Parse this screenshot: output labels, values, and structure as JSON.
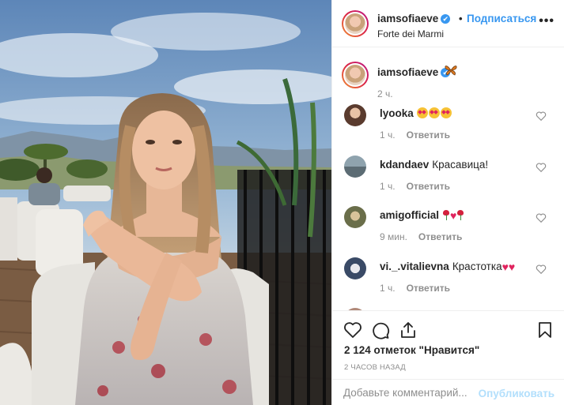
{
  "post": {
    "username": "iamsofiaeve",
    "verified_glyph": "✔",
    "dot": "•",
    "follow_label": "Подписаться",
    "location": "Forte dei Marmi",
    "more_glyph": "•••",
    "photo_description_icon": "photo"
  },
  "caption": {
    "username": "iamsofiaeve",
    "emoji": "butterfly",
    "time": "2 ч."
  },
  "comments": [
    {
      "username": "lyooka",
      "text": "",
      "emojis": [
        "heart-eyes",
        "heart-eyes",
        "heart-eyes"
      ],
      "time": "1 ч.",
      "reply": "Ответить",
      "avatar_color": "#5a3b2e"
    },
    {
      "username": "kdandaev",
      "text": "Красавица!",
      "emojis": [],
      "time": "1 ч.",
      "reply": "Ответить",
      "avatar_color": "#6f7f86"
    },
    {
      "username": "amigofficial",
      "text": "",
      "emojis": [
        "rose",
        "red-heart",
        "rose"
      ],
      "time": "9 мин.",
      "reply": "Ответить",
      "avatar_color": "#6a6e4a"
    },
    {
      "username": "vi._.vitalievna",
      "text": "Крастотка",
      "emojis": [
        "sparkling-heart",
        "sparkling-heart"
      ],
      "time": "1 ч.",
      "reply": "Ответить",
      "avatar_color": "#3a4a66"
    }
  ],
  "actions": {
    "like_icon": "heart-outline-icon",
    "comment_icon": "comment-icon",
    "share_icon": "share-icon",
    "save_icon": "bookmark-icon",
    "likes_text": "2 124 отметок \"Нравится\"",
    "ago_text": "2 ЧАСОВ НАЗАД"
  },
  "add_comment": {
    "placeholder": "Добавьте комментарий...",
    "post_label": "Опубликовать"
  },
  "colors": {
    "link": "#3897f0",
    "muted": "#8e8e8e",
    "post_disabled": "#b2dffc"
  }
}
